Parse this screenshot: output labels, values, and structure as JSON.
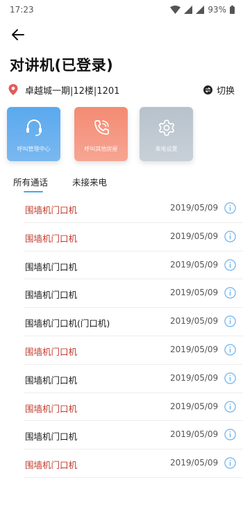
{
  "status_bar": {
    "time": "17:23",
    "battery": "93%"
  },
  "header": {
    "title": "对讲机(已登录)"
  },
  "location": {
    "address": "卓越城一期|12楼|1201",
    "switch_label": "切换"
  },
  "cards": [
    {
      "label": "呼叫管理中心",
      "icon": "headset-icon",
      "color": "#5aa9ee"
    },
    {
      "label": "呼叫其他房屋",
      "icon": "phone-call-icon",
      "color": "#f38b73"
    },
    {
      "label": "来电设置",
      "icon": "gear-icon",
      "color": "#b7c2cc"
    }
  ],
  "tabs": [
    {
      "label": "所有通话",
      "active": true
    },
    {
      "label": "未接来电",
      "active": false
    }
  ],
  "calls": [
    {
      "name": "围墙机门口机",
      "date": "2019/05/09",
      "missed": true
    },
    {
      "name": "围墙机门口机",
      "date": "2019/05/09",
      "missed": true
    },
    {
      "name": "围墙机门口机",
      "date": "2019/05/09",
      "missed": false
    },
    {
      "name": "围墙机门口机",
      "date": "2019/05/09",
      "missed": false
    },
    {
      "name": "围墙机门口机(门口机)",
      "date": "2019/05/09",
      "missed": false
    },
    {
      "name": "围墙机门口机",
      "date": "2019/05/09",
      "missed": true
    },
    {
      "name": "围墙机门口机",
      "date": "2019/05/09",
      "missed": false
    },
    {
      "name": "围墙机门口机",
      "date": "2019/05/09",
      "missed": true
    },
    {
      "name": "围墙机门口机",
      "date": "2019/05/09",
      "missed": false
    },
    {
      "name": "围墙机门口机",
      "date": "2019/05/09",
      "missed": true
    }
  ],
  "colors": {
    "missed": "#c0392b",
    "accent": "#4aa3f0",
    "location_pin": "#e35b5b"
  }
}
